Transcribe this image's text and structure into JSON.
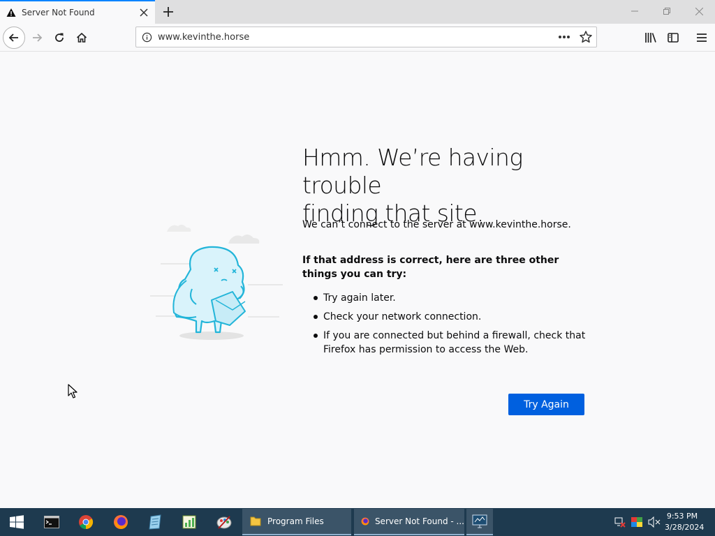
{
  "tab": {
    "title": "Server Not Found"
  },
  "navbar": {
    "url": "www.kevinthe.horse"
  },
  "content": {
    "heading_line1": "Hmm. We’re having trouble",
    "heading_line2": "finding that site.",
    "description": "We can’t connect to the server at www.kevinthe.horse.",
    "tips_heading": "If that address is correct, here are three other things you can try:",
    "tips": [
      "Try again later.",
      "Check your network connection.",
      "If you are connected but behind a firewall, check that Firefox has permission to access the Web."
    ],
    "try_again_label": "Try Again"
  },
  "taskbar": {
    "tasks": [
      {
        "label": "Program Files"
      },
      {
        "label": "Server Not Found - ..."
      }
    ],
    "clock_time": "9:53 PM",
    "clock_date": "3/28/2024"
  },
  "colors": {
    "accent": "#0060df",
    "taskbar": "#1e3a4f",
    "tab_highlight": "#0a84ff"
  }
}
